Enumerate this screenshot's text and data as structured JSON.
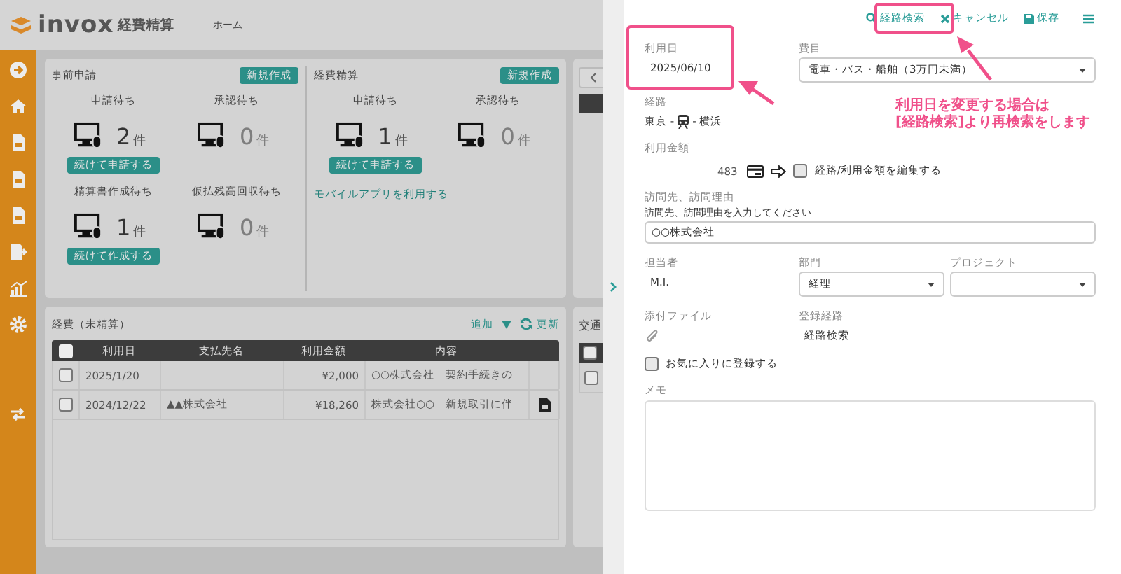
{
  "app": {
    "logo": "invox",
    "product": "経費精算",
    "nav": "ホーム"
  },
  "pre_application": {
    "title": "事前申請",
    "new_button": "新規作成",
    "stats": [
      {
        "label": "申請待ち",
        "count": "2",
        "unit": "件",
        "disabled": false,
        "action": "続けて申請する"
      },
      {
        "label": "承認待ち",
        "count": "0",
        "unit": "件",
        "disabled": true
      },
      {
        "label": "精算書作成待ち",
        "count": "1",
        "unit": "件",
        "disabled": false,
        "action": "続けて作成する"
      },
      {
        "label": "仮払残高回収待ち",
        "count": "0",
        "unit": "件",
        "disabled": true
      }
    ]
  },
  "expense_settlement": {
    "title": "経費精算",
    "new_button": "新規作成",
    "stats": [
      {
        "label": "申請待ち",
        "count": "1",
        "unit": "件",
        "disabled": false,
        "action": "続けて申請する"
      },
      {
        "label": "承認待ち",
        "count": "0",
        "unit": "件",
        "disabled": true
      }
    ],
    "link": "モバイルアプリを利用する"
  },
  "unsettled": {
    "title": "経費（未精算）",
    "add": "追加",
    "refresh": "更新",
    "select_all_checked": false,
    "columns": [
      "利用日",
      "支払先名",
      "利用金額",
      "内容"
    ],
    "rows": [
      {
        "checked": false,
        "date": "2025/1/20",
        "payee": "",
        "amount": "¥2,000",
        "content": "○○株式会社　契約手続きの",
        "attachment": false
      },
      {
        "checked": false,
        "date": "2024/12/22",
        "payee": "▲▲株式会社",
        "amount": "¥18,260",
        "content": "株式会社○○　新規取引に伴",
        "attachment": true
      }
    ]
  },
  "side_card": {
    "title": "交通",
    "select_all_checked": false,
    "row_checked": false
  },
  "form": {
    "toolbar": [
      {
        "kind": "search",
        "label": "経路検索"
      },
      {
        "kind": "cancel",
        "label": "キャンセル"
      },
      {
        "kind": "save",
        "label": "保存"
      },
      {
        "kind": "menu"
      }
    ],
    "date": {
      "label": "利用日",
      "value": "2025/06/10"
    },
    "category": {
      "label": "費目",
      "value": "電車・バス・船舶（3万円未満）"
    },
    "route": {
      "label": "経路",
      "from": "東京 -",
      "to": "- 横浜"
    },
    "amount": {
      "label": "利用金額",
      "value": "483",
      "edit_label": "経路/利用金額を編集する",
      "edit_checked": false
    },
    "visit": {
      "label": "訪問先、訪問理由",
      "hint": "訪問先、訪問理由を入力してください",
      "value": "○○株式会社"
    },
    "person": {
      "label": "担当者",
      "value": "M.I."
    },
    "department": {
      "label": "部門",
      "value": "経理"
    },
    "project": {
      "label": "プロジェクト"
    },
    "attachment": {
      "label": "添付ファイル"
    },
    "registration_route": {
      "label": "登録経路",
      "value": "経路検索"
    },
    "favorite": {
      "label": "お気に入りに登録する",
      "checked": false
    },
    "memo": {
      "label": "メモ"
    }
  },
  "annotation": {
    "callout": "利用日を変更する場合は\n[経路検索]より再検索をします"
  }
}
